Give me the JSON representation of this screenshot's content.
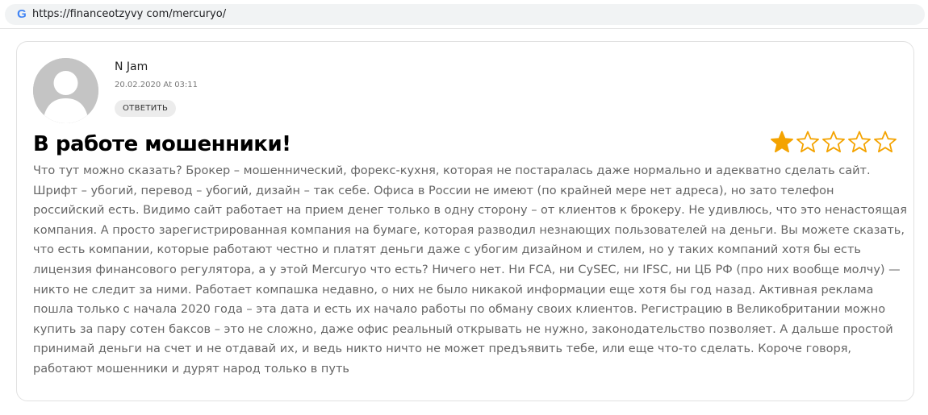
{
  "browser": {
    "url": "https://financeotzyvy com/mercuryo/",
    "icon": "google-g-icon",
    "icon_glyph": "G"
  },
  "review": {
    "author": "N Jam",
    "date": "20.02.2020 At 03:11",
    "reply_label": "ОТВЕТИТЬ",
    "title": "В работе мошенники!",
    "rating": 1,
    "rating_max": 5,
    "star_color": "#f4a300",
    "text": "Что тут можно сказать? Брокер – мошеннический, форекс-кухня, которая не постаралась даже нормально и адекватно сделать сайт. Шрифт – убогий, перевод – убогий, дизайн – так себе. Офиса в России не имеют (по крайней мере нет адреса), но зато телефон российский есть. Видимо сайт работает на прием денег только в одну сторону – от клиентов к брокеру. Не удивлюсь, что это ненастоящая компания. А просто зарегистрированная компания на бумаге, которая разводил незнающих пользователей на деньги. Вы можете сказать, что есть компании, которые работают честно и платят деньги даже с убогим дизайном и стилем, но у таких компаний хотя бы есть лицензия финансового регулятора, а у этой Mercuryo что есть? Ничего нет. Ни FCA, ни CySEC, ни IFSC, ни ЦБ РФ (про них вообще молчу) — никто не следит за ними. Работает компашка недавно, о них не было никакой информации еще хотя бы год назад. Активная реклама пошла только с начала 2020 года – эта дата и есть их начало работы по обману своих клиентов. Регистрацию в Великобритании можно купить за пару сотен баксов – это не сложно, даже офис реальный открывать не нужно, законодательство позволяет. А дальше простой принимай деньги на счет и не отдавай их, и ведь никто ничто не может предъявить тебе, или еще что-то сделать. Короче говоря, работают мошенники и дурят народ только в путь"
  }
}
